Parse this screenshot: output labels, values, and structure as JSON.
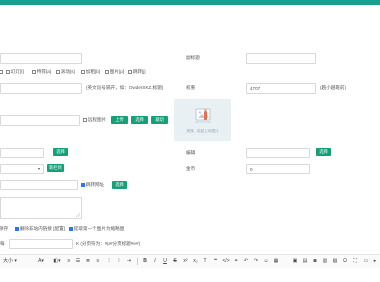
{
  "theme": {
    "accent": "#15a077",
    "topbar": "#1aa08e",
    "checked": "#2b76f0"
  },
  "right": {
    "title_label": "副标题",
    "weight_label": "权重",
    "weight_value": "4707",
    "weight_hint": "(越小越靠前)",
    "sort_label": "编辑",
    "money_label": "金币",
    "money_value": "0"
  },
  "flags": [
    "头条[h]",
    "幻灯[f]",
    "特荐[a]",
    "滚动[s]",
    "加粗[b]",
    "图片[p]",
    "跳转[j]"
  ],
  "keyword_hint": "(英文逗号隔开，如：OwderSKZ,标题)",
  "thumb": {
    "remote_label": "远程图片",
    "upload_btn": "上传",
    "select_btn": "选择",
    "crop_btn": "裁切"
  },
  "upload_caption": "拖拽、粘贴上传图片",
  "buttons": {
    "choose_1": "选择",
    "choose_2": "选择",
    "choose_3": "选择",
    "new_column": "新栏目"
  },
  "jump": {
    "label": "跳转网址"
  },
  "options": {
    "opt1": "保存",
    "opt2": "删除非站内链接 [配置]",
    "opt3": "提取第一个图片为缩略图"
  },
  "paging": {
    "prefix": "每",
    "unit": "K (分页符为：#p#分页标题#e#)"
  },
  "editor": {
    "font_size": "大小",
    "tools": [
      "A",
      "B",
      "I",
      "U",
      "S",
      "x²",
      "x₂",
      "T",
      "99",
      "</>",
      "Ω"
    ]
  }
}
